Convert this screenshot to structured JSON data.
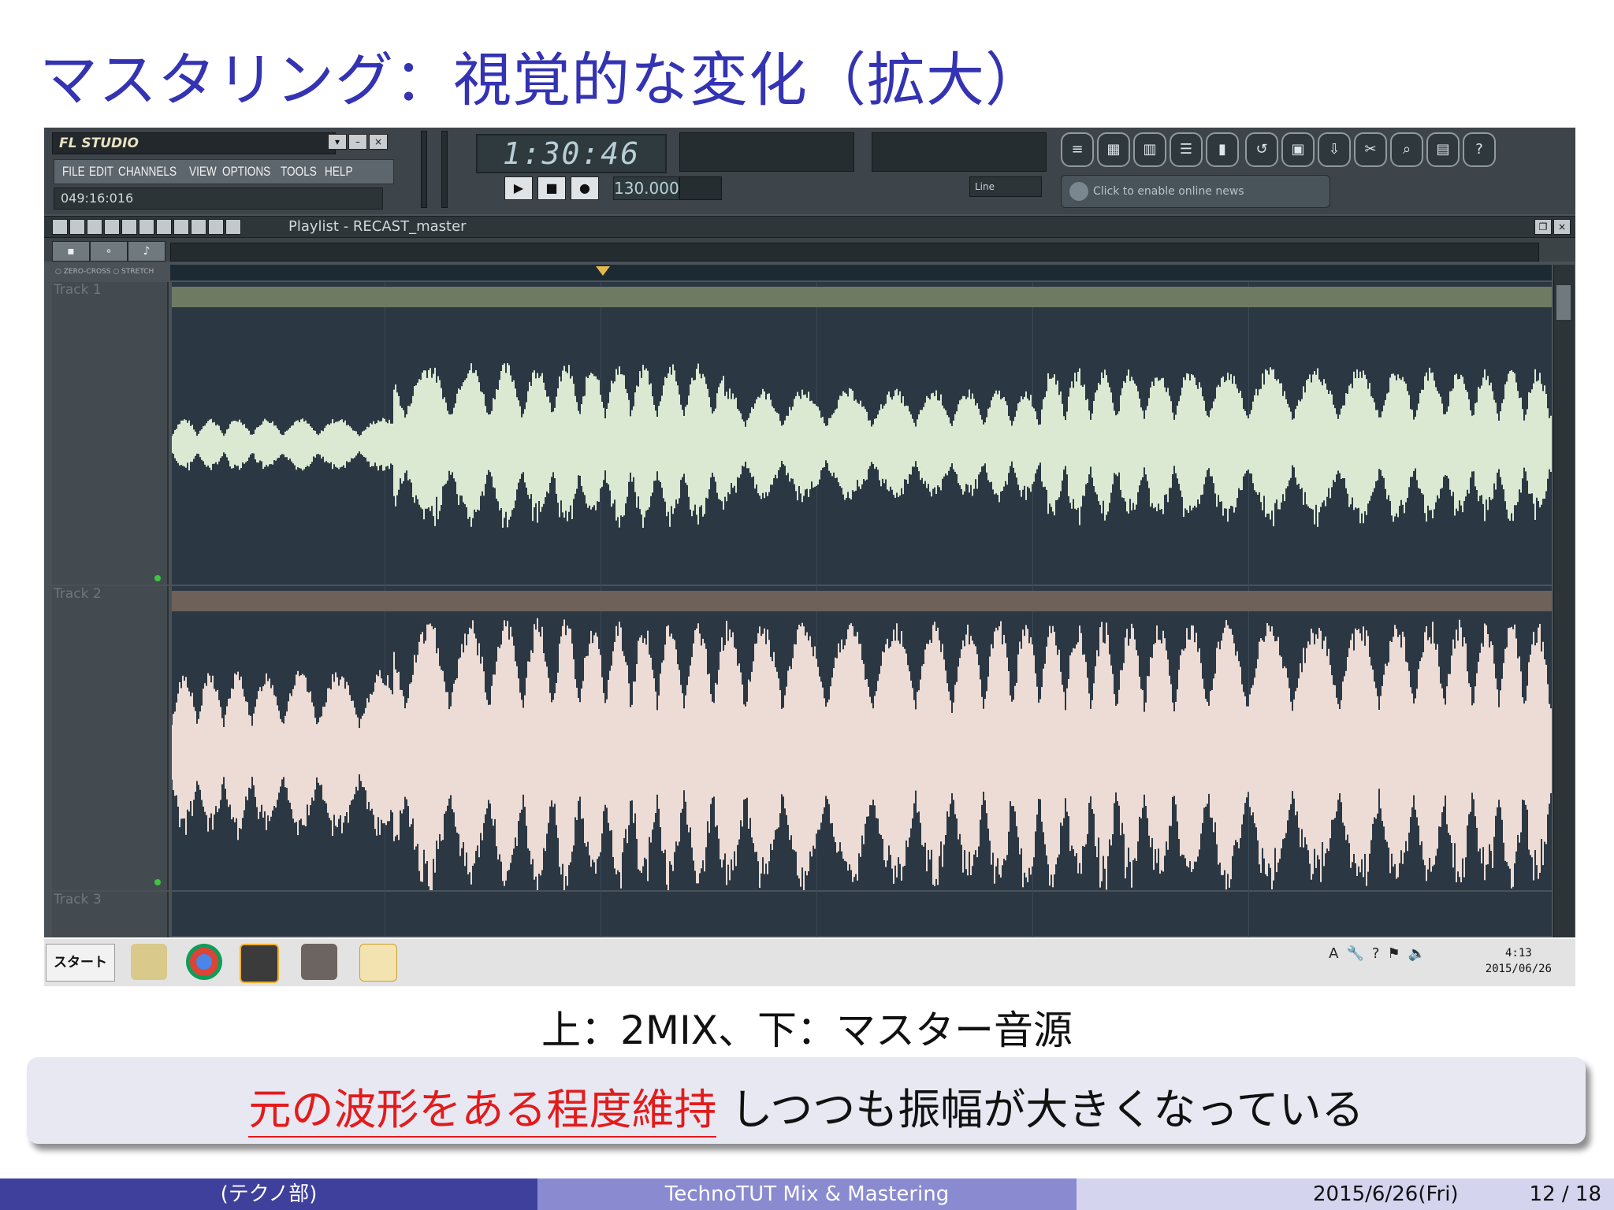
{
  "slide": {
    "title": "マスタリング：視覚的な変化（拡大）",
    "caption": "上：2MIX、下：マスター音源",
    "block_highlight": "元の波形をある程度維持",
    "block_rest": " しつつも振幅が大きくなっている"
  },
  "footer": {
    "left": "(テクノ部)",
    "center": "TechnoTUT Mix & Mastering",
    "date": "2015/6/26(Fri)",
    "page": "12 / 18"
  },
  "fl": {
    "logo": "FL STUDIO",
    "menu": [
      "FILE",
      "EDIT",
      "CHANNELS",
      "VIEW",
      "OPTIONS",
      "TOOLS",
      "HELP"
    ],
    "song_position": "049:16:016",
    "time": "1:30:46",
    "tempo": "130.000",
    "snap": "Line",
    "news": "Click to enable online news",
    "playlist_title": "Playlist - RECAST_master",
    "opt1": "ZERO-CROSS",
    "opt2": "STRETCH",
    "tracks": [
      "Track 1",
      "Track 2",
      "Track 3"
    ]
  },
  "taskbar": {
    "start": "スタート",
    "time": "4:13",
    "date": "2015/06/26"
  },
  "colors": {
    "title": "#3333b3",
    "wave1": "#dbe9d3",
    "wave2": "#ecdcd5",
    "highlight": "#e21b1b"
  }
}
